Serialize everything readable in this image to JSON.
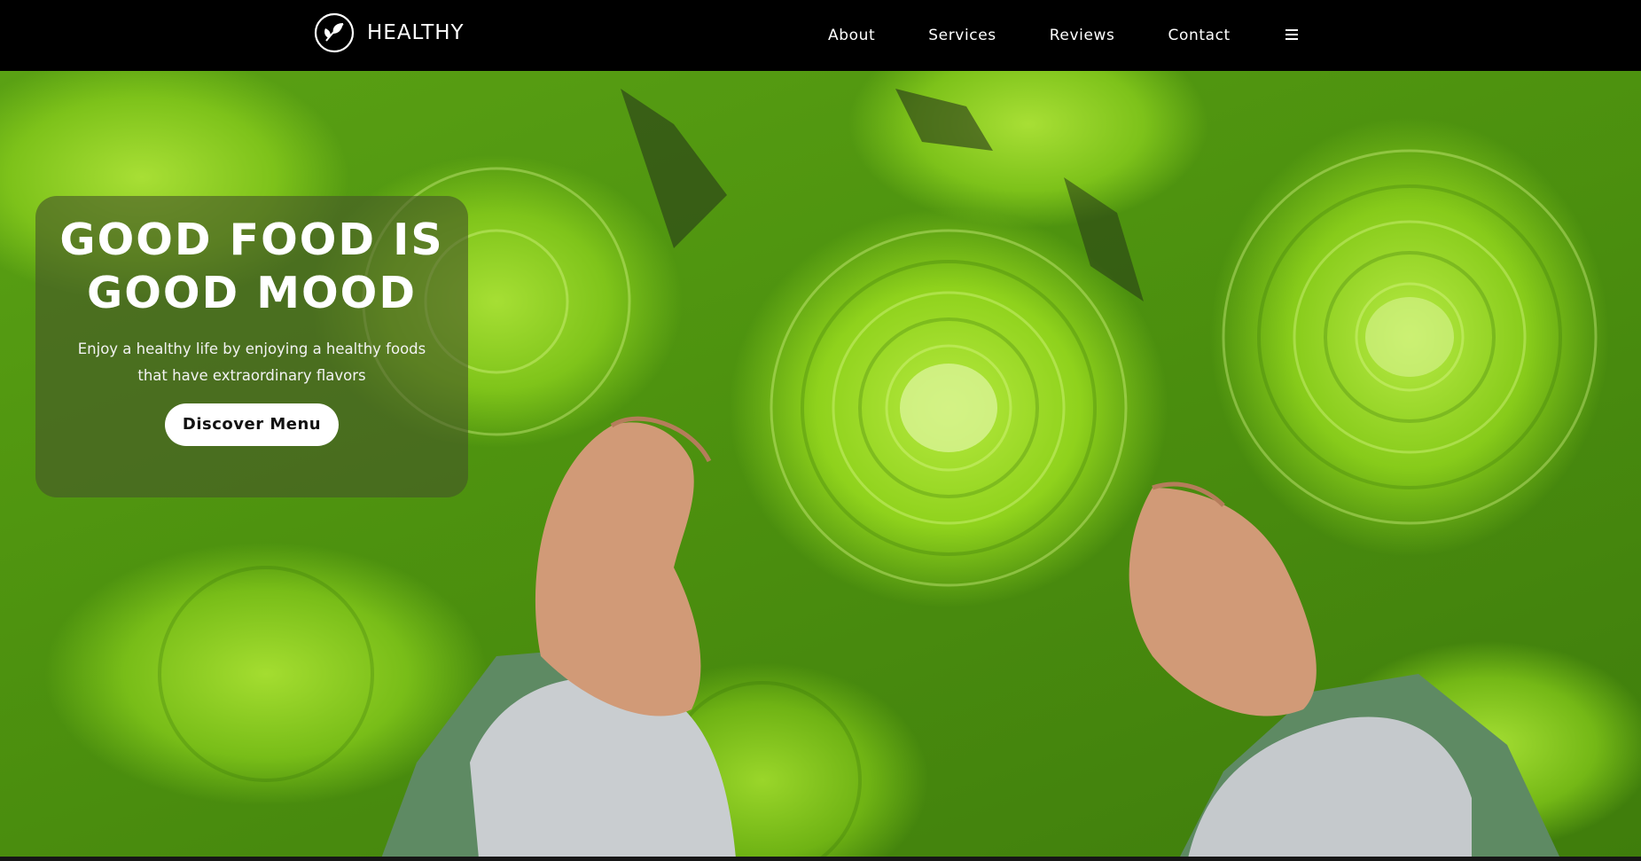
{
  "header": {
    "brand_name": "HEALTHY",
    "logo_icon": "leaf-circle-icon",
    "nav": {
      "about": "About",
      "services": "Services",
      "reviews": "Reviews",
      "contact": "Contact"
    },
    "menu_icon": "hamburger-icon"
  },
  "hero": {
    "title_line1": "GOOD FOOD IS",
    "title_line2": "GOOD MOOD",
    "subtitle": "Enjoy a healthy life by enjoying a healthy foods that have extraordinary flavors",
    "cta_label": "Discover Menu"
  },
  "colors": {
    "header_bg": "#000000",
    "card_overlay": "#465528",
    "text_primary": "#ffffff",
    "button_bg": "#ffffff",
    "button_text": "#111111"
  }
}
